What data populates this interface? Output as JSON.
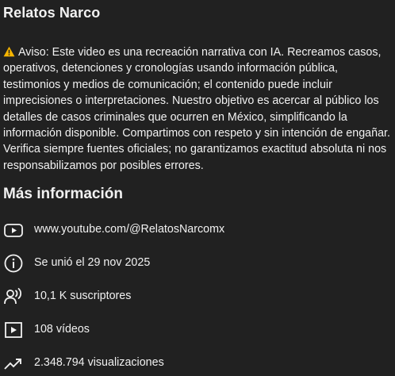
{
  "channel": {
    "name": "Relatos Narco"
  },
  "description": {
    "icon": "warning-icon",
    "text": "Aviso: Este video es una recreación narrativa con IA. Recreamos casos, operativos, detenciones y cronologías usando información pública, testimonios y medios de comunicación; el contenido puede incluir imprecisiones o interpretaciones. Nuestro objetivo es acercar al público los detalles de casos criminales que ocurren en México, simplificando la información disponible. Compartimos con respeto y sin intención de engañar. Verifica siempre fuentes oficiales; no garantizamos exactitud absoluta ni nos responsabilizamos por posibles errores."
  },
  "more_info": {
    "title": "Más información",
    "rows": [
      {
        "icon": "youtube-play-icon",
        "text": "www.youtube.com/@RelatosNarcomx"
      },
      {
        "icon": "info-icon",
        "text": "Se unió el 29 nov 2025"
      },
      {
        "icon": "subscribers-icon",
        "text": "10,1 K suscriptores"
      },
      {
        "icon": "video-icon",
        "text": "108 vídeos"
      },
      {
        "icon": "trending-icon",
        "text": "2.348.794 visualizaciones"
      }
    ]
  },
  "colors": {
    "background": "#212121",
    "text": "#f1f1f1",
    "warning_yellow": "#f5b400"
  }
}
